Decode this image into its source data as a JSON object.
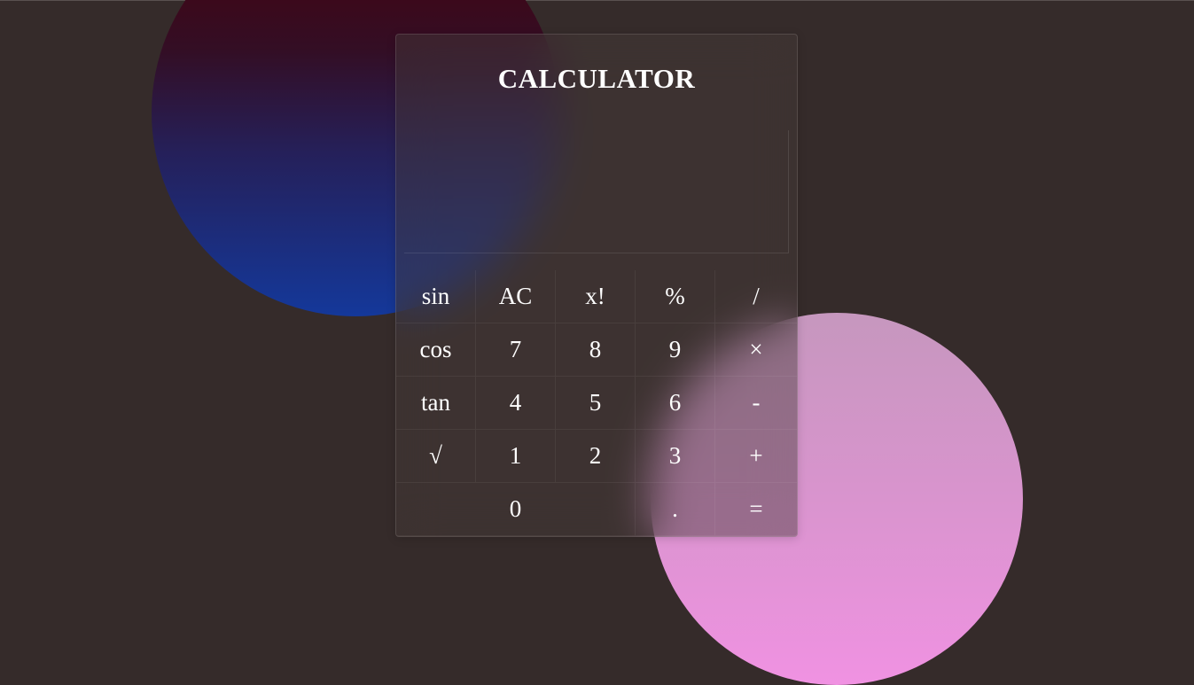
{
  "app": {
    "title": "CALCULATOR"
  },
  "display": {
    "value": ""
  },
  "keys": {
    "row1": [
      "sin",
      "AC",
      "x!",
      "%",
      "/"
    ],
    "row2": [
      "cos",
      "7",
      "8",
      "9",
      "×"
    ],
    "row3": [
      "tan",
      "4",
      "5",
      "6",
      "-"
    ],
    "row4": [
      "√",
      "1",
      "2",
      "3",
      "+"
    ],
    "row5": [
      "",
      "0",
      ".",
      "="
    ]
  },
  "colors": {
    "background": "#352b2a",
    "text": "#ffffff",
    "blob_top_red": "#4a000a",
    "blob_bottom_blue": "#14389a",
    "blob_pink_light": "#c697be",
    "blob_pink_bright": "#f092e2"
  }
}
